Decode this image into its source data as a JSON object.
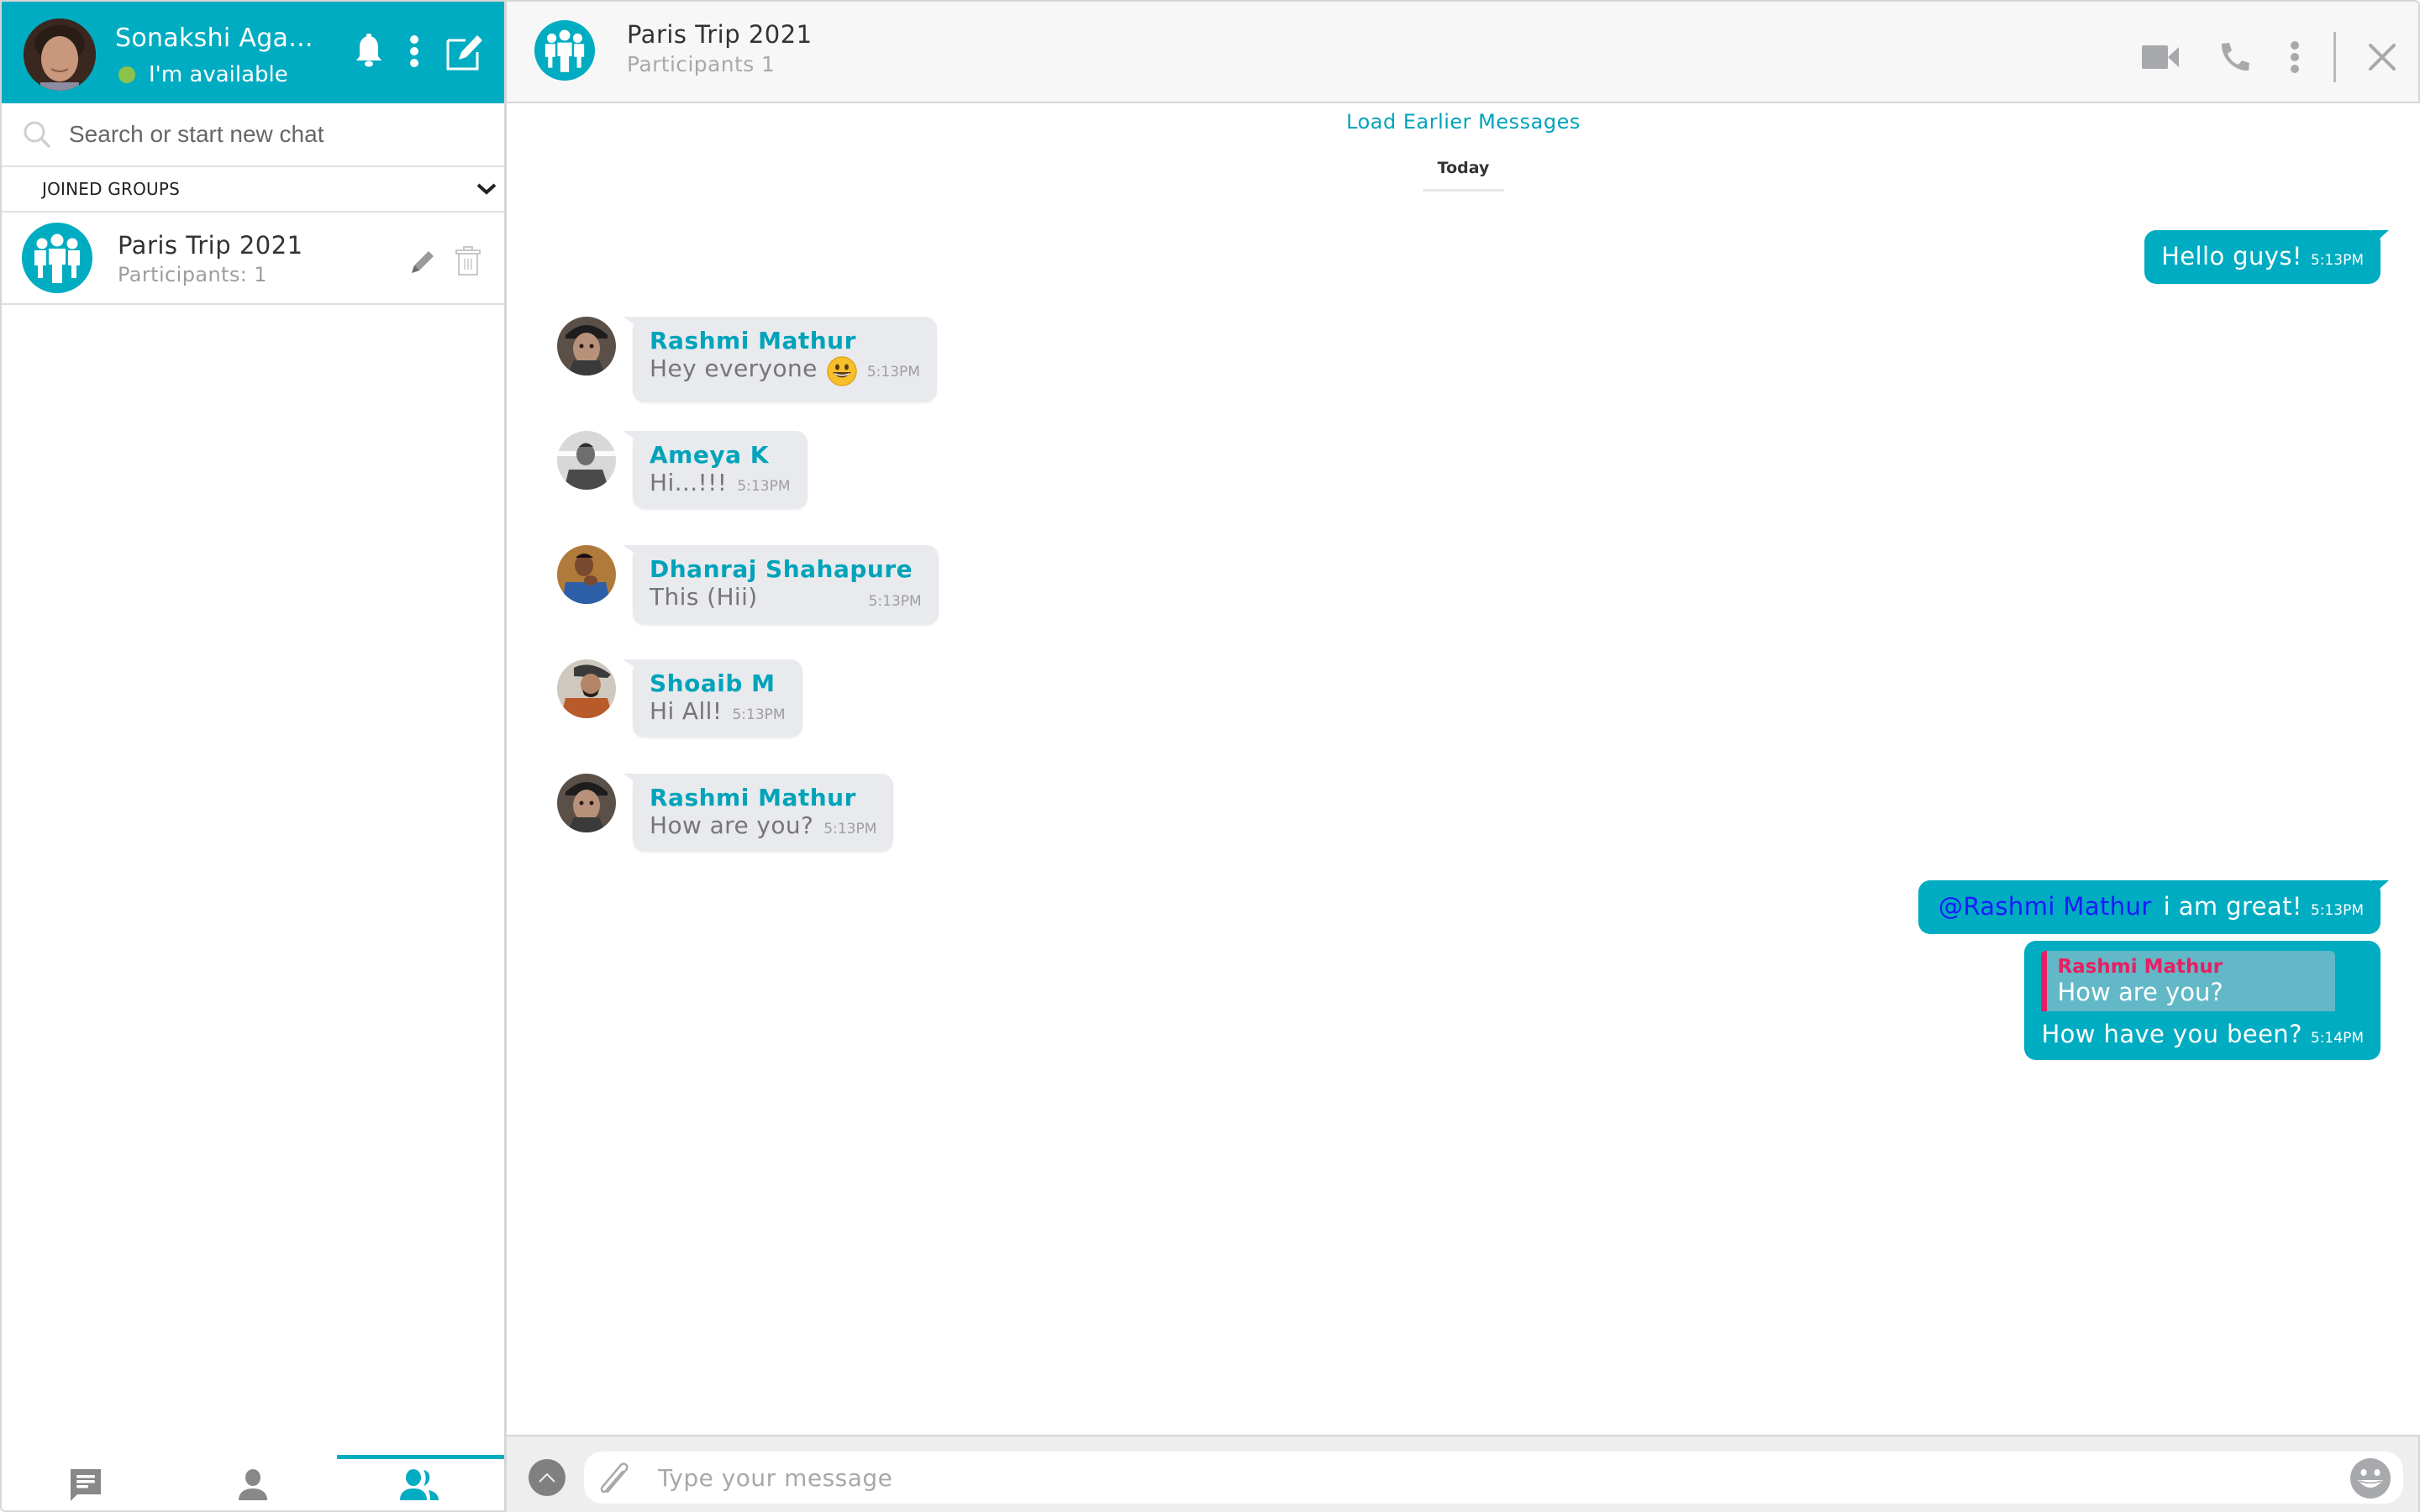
{
  "profile": {
    "name": "Sonakshi Aga...",
    "status": "I'm available",
    "status_color": "#8bc34a",
    "icons": [
      "bell-icon",
      "more-vertical-icon",
      "compose-icon"
    ]
  },
  "search": {
    "placeholder": "Search or start new chat",
    "value": ""
  },
  "sidebar": {
    "section_label": "JOINED GROUPS",
    "groups": [
      {
        "name": "Paris Trip 2021",
        "subtitle": "Participants: 1"
      }
    ],
    "tabs": [
      {
        "name": "chats",
        "icon": "chat-icon",
        "active": false
      },
      {
        "name": "contacts",
        "icon": "person-icon",
        "active": false
      },
      {
        "name": "groups",
        "icon": "group-icon",
        "active": true
      }
    ]
  },
  "chat": {
    "title": "Paris Trip 2021",
    "subtitle": "Participants 1",
    "header_actions": [
      "video-call-icon",
      "phone-icon",
      "more-vertical-icon",
      "close-icon"
    ],
    "load_earlier": "Load Earlier Messages",
    "date_separator": "Today",
    "messages": [
      {
        "direction": "out",
        "text": "Hello guys!",
        "time": "5:13PM"
      },
      {
        "direction": "in",
        "sender": "Rashmi Mathur",
        "text": "Hey everyone",
        "emoji": "😃",
        "time": "5:13PM"
      },
      {
        "direction": "in",
        "sender": "Ameya K",
        "text": "Hi...!!!",
        "time": "5:13PM"
      },
      {
        "direction": "in",
        "sender": "Dhanraj Shahapure",
        "text": "This (Hii)",
        "time": "5:13PM"
      },
      {
        "direction": "in",
        "sender": "Shoaib M",
        "text": "Hi All!",
        "time": "5:13PM"
      },
      {
        "direction": "in",
        "sender": "Rashmi Mathur",
        "text": "How are you?",
        "time": "5:13PM"
      },
      {
        "direction": "out",
        "mention": "@Rashmi Mathur",
        "text": "i am great!",
        "time": "5:13PM"
      },
      {
        "direction": "out",
        "reply_to": {
          "sender": "Rashmi Mathur",
          "text": "How are you?"
        },
        "text": "How have you been?",
        "time": "5:14PM"
      }
    ]
  },
  "composer": {
    "placeholder": "Type your message",
    "value": ""
  },
  "colors": {
    "accent": "#00acc1",
    "incoming_bubble": "#e8eaee",
    "reply_bar": "#e91e63",
    "mention": "#1a1aff"
  }
}
